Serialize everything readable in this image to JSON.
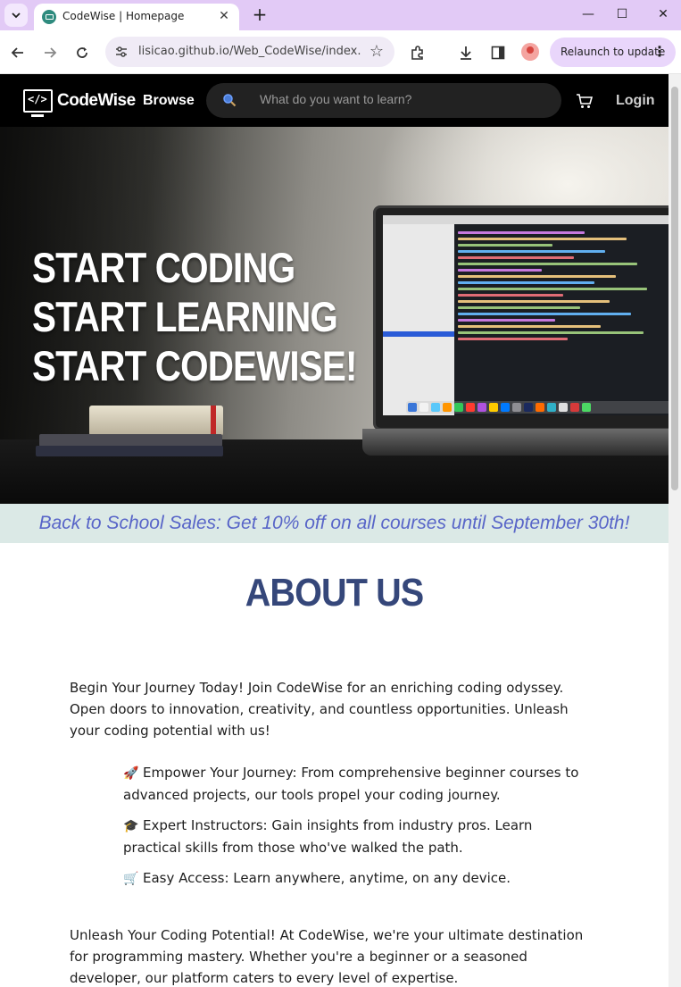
{
  "browser": {
    "tab_title": "CodeWise | Homepage",
    "url": "lisicao.github.io/Web_CodeWise/index...",
    "relaunch_label": "Relaunch to update"
  },
  "site": {
    "logo_text": "CodeWise",
    "nav_browse": "Browse",
    "search_placeholder": "What do you want to learn?",
    "login": "Login"
  },
  "hero": {
    "lines": [
      "START CODING",
      "START LEARNING",
      "START CODEWISE!"
    ]
  },
  "sale_banner": "Back to School Sales: Get 10% off on all courses until September 30th!",
  "about": {
    "title": "ABOUT US",
    "intro": "Begin Your Journey Today! Join CodeWise for an enriching coding odyssey. Open doors to innovation, creativity, and countless opportunities. Unleash your coding potential with us!",
    "features": [
      {
        "emoji": "🚀",
        "text": "Empower Your Journey: From comprehensive beginner courses to advanced projects, our tools propel your coding journey."
      },
      {
        "emoji": "🎓",
        "text": "Expert Instructors: Gain insights from industry pros. Learn practical skills from those who've walked the path."
      },
      {
        "emoji": "🛒",
        "text": "Easy Access: Learn anywhere, anytime, on any device."
      }
    ],
    "paragraph2": "Unleash Your Coding Potential! At CodeWise, we're your ultimate destination for programming mastery. Whether you're a beginner or a seasoned developer, our platform caters to every level of expertise."
  },
  "icons": {
    "tab_favicon": "monitor-icon",
    "back": "back-arrow-icon",
    "forward": "forward-arrow-icon",
    "reload": "reload-icon",
    "site_info": "site-settings-icon",
    "bookmark": "star-icon",
    "extensions": "puzzle-icon",
    "downloads": "download-icon",
    "side_panel": "side-panel-icon",
    "search": "search-icon",
    "cart": "cart-icon"
  },
  "colors": {
    "tabbar": "#e2caf6",
    "sale_banner_bg": "#dbe9e6",
    "sale_banner_text": "#5865c8",
    "about_title": "#35477a"
  }
}
